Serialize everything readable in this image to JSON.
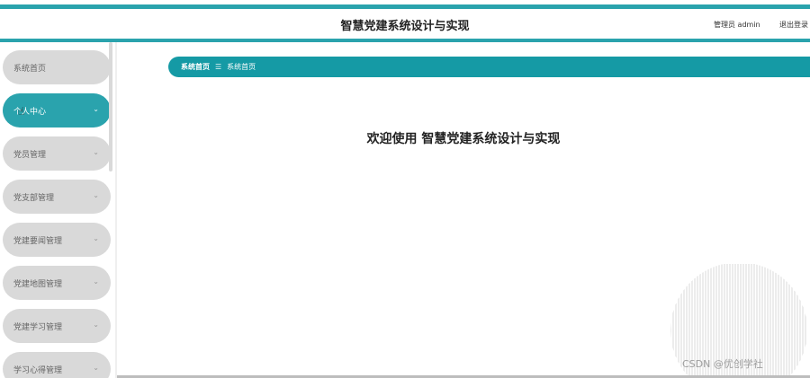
{
  "header": {
    "title": "智慧党建系统设计与实现",
    "user_label": "管理员 admin",
    "logout_label": "退出登录"
  },
  "sidebar": {
    "items": [
      {
        "label": "系统首页",
        "active": false
      },
      {
        "label": "个人中心",
        "active": true
      },
      {
        "label": "党员管理",
        "active": false
      },
      {
        "label": "党支部管理",
        "active": false
      },
      {
        "label": "党建要闻管理",
        "active": false
      },
      {
        "label": "党建地图管理",
        "active": false
      },
      {
        "label": "党建学习管理",
        "active": false
      },
      {
        "label": "学习心得管理",
        "active": false
      }
    ]
  },
  "breadcrumb": {
    "home": "系统首页",
    "separator": "☰",
    "current": "系统首页"
  },
  "main": {
    "welcome": "欢迎使用 智慧党建系统设计与实现"
  },
  "watermark": {
    "text": "CSDN @优创学社"
  },
  "colors": {
    "accent": "#2aa3ad",
    "breadcrumb_bg": "#159aa5",
    "nav_inactive": "#d9d9d9"
  }
}
